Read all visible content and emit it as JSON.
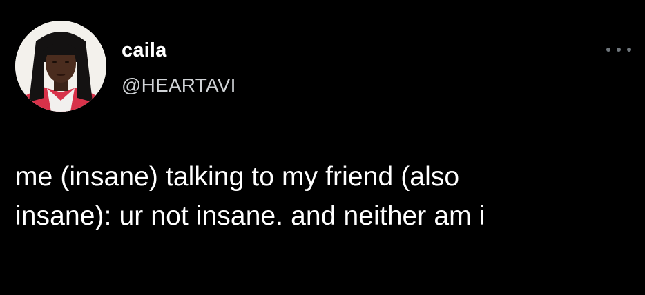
{
  "tweet": {
    "author": {
      "display_name": "caila",
      "handle": "@HEARTAVI"
    },
    "text_lines": [
      "me (insane) talking to my friend (also",
      "insane): ur not insane. and neither am i"
    ],
    "more_icon": "ellipsis-icon"
  },
  "colors": {
    "background": "#000000",
    "text": "#ffffff",
    "handle": "#d0d3d6",
    "more_dots": "#6f767c"
  }
}
